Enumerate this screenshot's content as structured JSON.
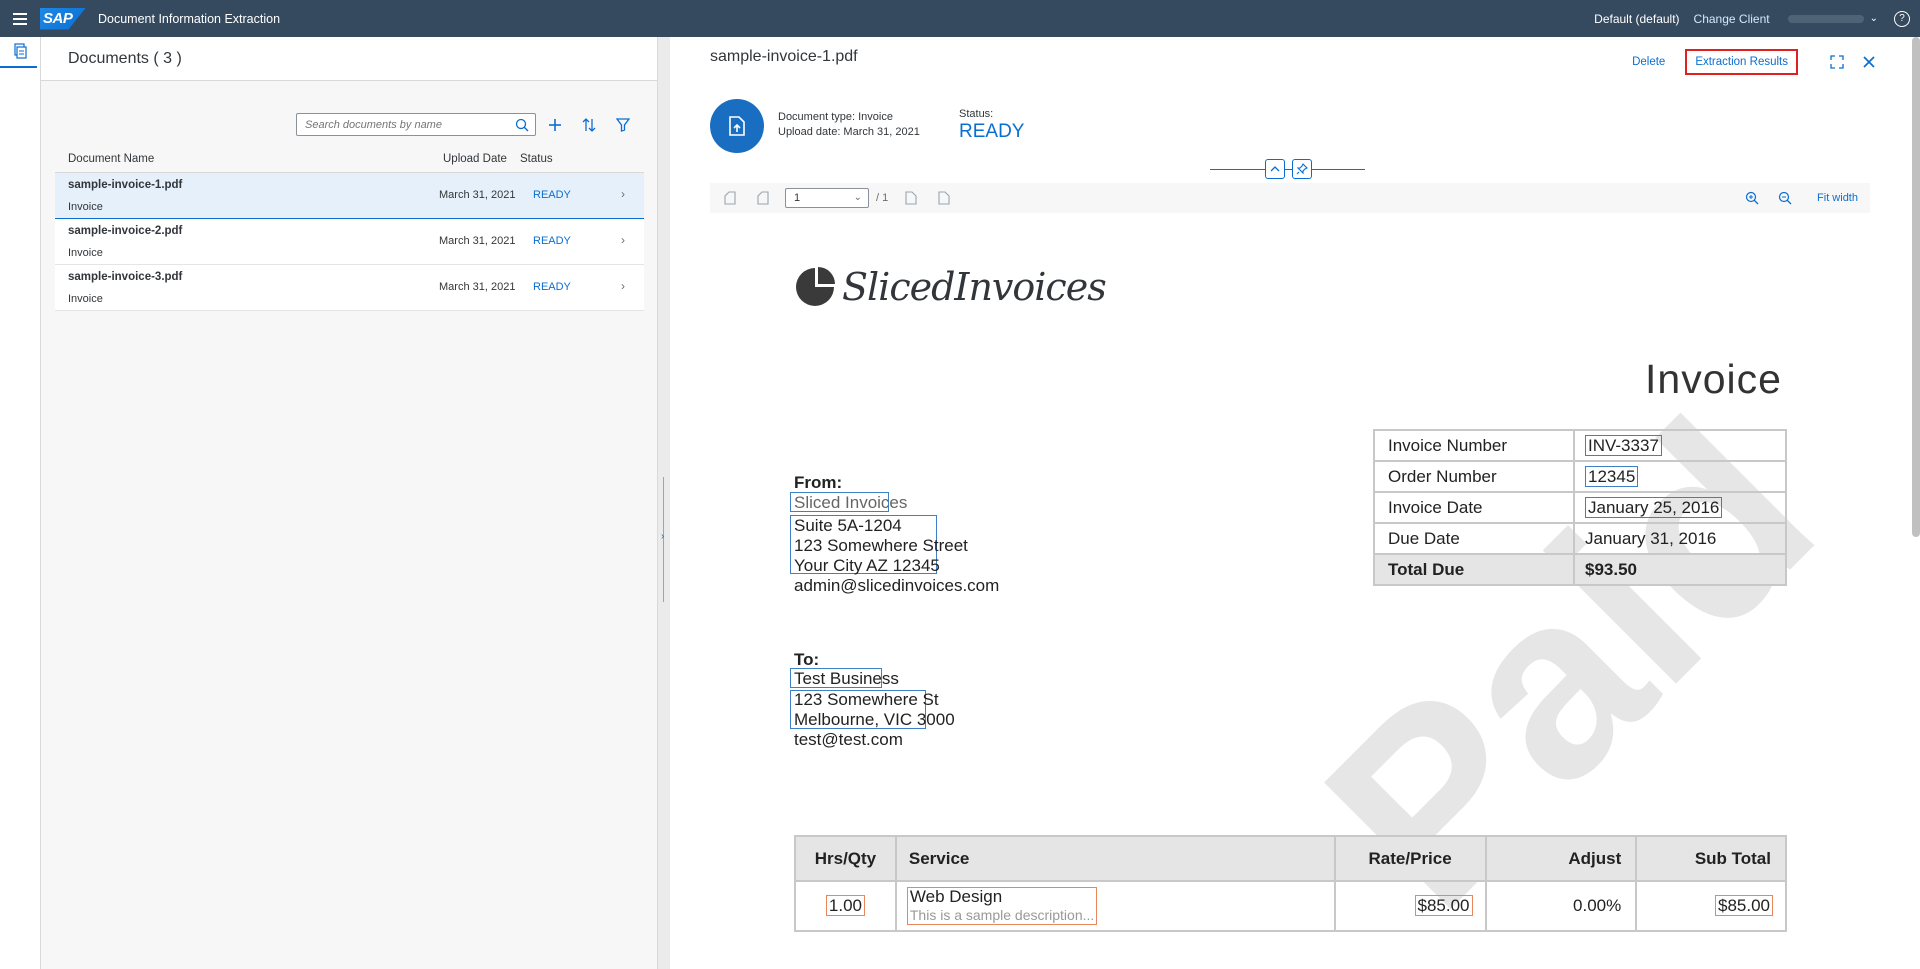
{
  "shell": {
    "logo_text": "SAP",
    "app_title": "Document Information Extraction",
    "default_label": "Default (default)",
    "change_client": "Change Client",
    "help": "?"
  },
  "documents": {
    "header": "Documents ( 3 )",
    "search_placeholder": "Search documents by name",
    "columns": {
      "name": "Document Name",
      "date": "Upload Date",
      "status": "Status"
    },
    "rows": [
      {
        "name": "sample-invoice-1.pdf",
        "type": "Invoice",
        "date": "March 31, 2021",
        "status": "READY"
      },
      {
        "name": "sample-invoice-2.pdf",
        "type": "Invoice",
        "date": "March 31, 2021",
        "status": "READY"
      },
      {
        "name": "sample-invoice-3.pdf",
        "type": "Invoice",
        "date": "March 31, 2021",
        "status": "READY"
      }
    ]
  },
  "detail": {
    "title": "sample-invoice-1.pdf",
    "delete": "Delete",
    "extraction_results": "Extraction Results",
    "doc_type": "Document type: Invoice",
    "upload_date": "Upload date: March 31, 2021",
    "status_label": "Status:",
    "status_value": "READY"
  },
  "viewer": {
    "page_value": "1",
    "page_of": "/ 1",
    "fit_width": "Fit width"
  },
  "invoice": {
    "logo_text": "SlicedInvoices",
    "title": "Invoice",
    "from_label": "From:",
    "from_company": "Sliced Invoices",
    "from_addr1": "Suite 5A-1204",
    "from_addr2": "123 Somewhere Street",
    "from_addr3": "Your City AZ 12345",
    "from_email": "admin@slicedinvoices.com",
    "to_label": "To:",
    "to_company": "Test Business",
    "to_addr1": "123 Somewhere St",
    "to_addr2": "Melbourne, VIC 3000",
    "to_email": "test@test.com",
    "kv": [
      {
        "k": "Invoice Number",
        "v": "INV-3337"
      },
      {
        "k": "Order Number",
        "v": "12345"
      },
      {
        "k": "Invoice Date",
        "v": "January 25, 2016"
      },
      {
        "k": "Due Date",
        "v": "January 31, 2016"
      },
      {
        "k": "Total Due",
        "v": "$93.50"
      }
    ],
    "svc_headers": [
      "Hrs/Qty",
      "Service",
      "Rate/Price",
      "Adjust",
      "Sub Total"
    ],
    "svc_row": {
      "qty": "1.00",
      "service": "Web Design",
      "desc": "This is a sample description...",
      "rate": "$85.00",
      "adjust": "0.00%",
      "subtotal": "$85.00"
    },
    "watermark": "Paid"
  },
  "colors": {
    "shell": "#354a5f",
    "accent": "#0a6ed1",
    "highlight": "#e02020"
  }
}
